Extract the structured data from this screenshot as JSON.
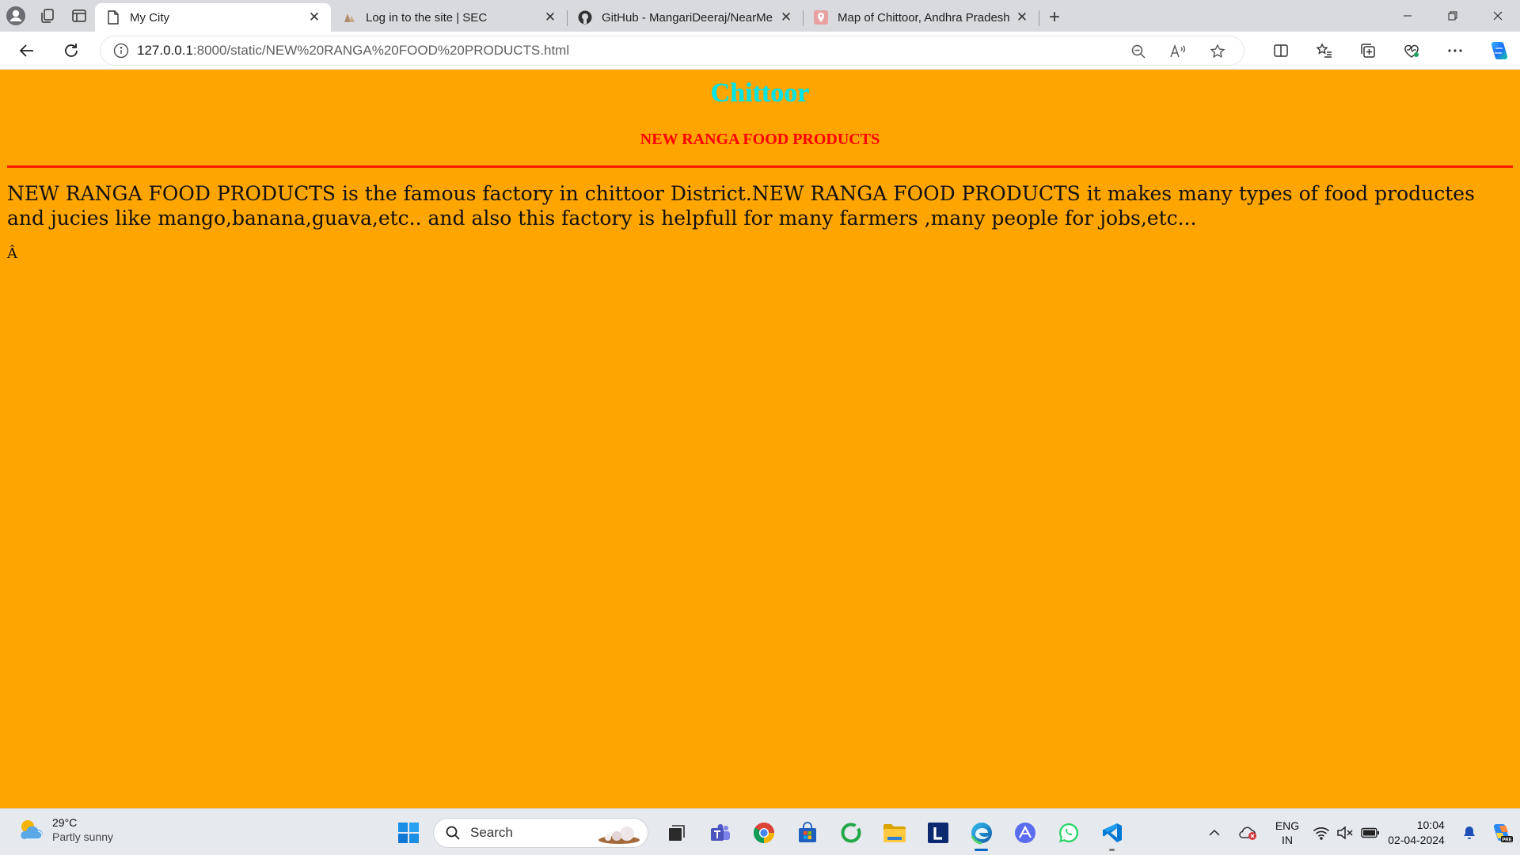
{
  "browser": {
    "tabs": [
      {
        "title": "My City",
        "icon": "page-icon",
        "active": true
      },
      {
        "title": "Log in to the site | SEC",
        "icon": "site-favicon",
        "active": false
      },
      {
        "title": "GitHub - MangariDeeraj/NearMe",
        "icon": "github-icon",
        "active": false
      },
      {
        "title": "Map of Chittoor, Andhra Pradesh",
        "icon": "map-pin-icon",
        "active": false
      }
    ],
    "address": {
      "host": "127.0.0.1",
      "path": ":8000/static/NEW%20RANGA%20FOOD%20PRODUCTS.html"
    }
  },
  "page": {
    "city": "Chittoor",
    "subtitle": "NEW RANGA FOOD PRODUCTS",
    "description": "NEW RANGA FOOD PRODUCTS is the famous factory in chittoor District.NEW RANGA FOOD PRODUCTS it makes many types of food productes and jucies like mango,banana,guava,etc.. and also this factory is helpfull for many farmers ,many people for jobs,etc...",
    "stray": "Â",
    "colors": {
      "background": "#ffa500",
      "title": "#00e5e5",
      "subtitle": "#ff0000",
      "rule": "#ff1a00"
    }
  },
  "taskbar": {
    "weather": {
      "temp": "29°C",
      "condition": "Partly sunny"
    },
    "search_placeholder": "Search",
    "lang": {
      "line1": "ENG",
      "line2": "IN"
    },
    "clock": {
      "time": "10:04",
      "date": "02-04-2024"
    }
  }
}
